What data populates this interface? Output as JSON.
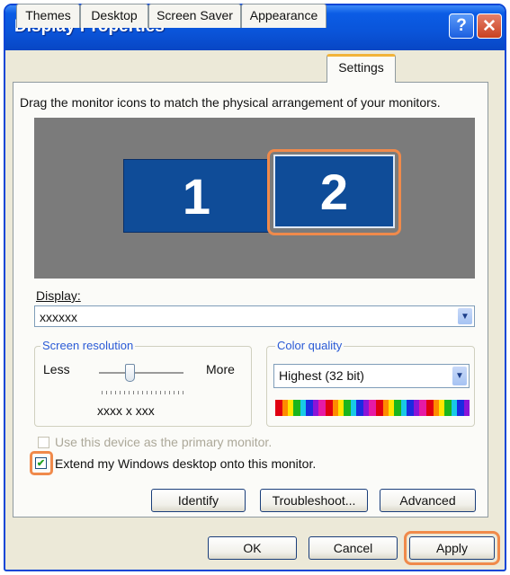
{
  "window": {
    "title": "Display Properties"
  },
  "titlebar": {
    "help_label": "?",
    "close_label": "✕"
  },
  "tabs": [
    {
      "label": "Themes"
    },
    {
      "label": "Desktop"
    },
    {
      "label": "Screen Saver"
    },
    {
      "label": "Appearance"
    },
    {
      "label": "Settings"
    }
  ],
  "settings": {
    "instruction": "Drag the monitor icons to match the physical arrangement of your monitors.",
    "monitors": [
      {
        "label": "1"
      },
      {
        "label": "2"
      }
    ],
    "display": {
      "label": "Display:",
      "value": "xxxxxx"
    },
    "screen_resolution": {
      "title": "Screen resolution",
      "less_label": "Less",
      "more_label": "More",
      "value": "xxxx x xxx"
    },
    "color_quality": {
      "title": "Color quality",
      "value": "Highest (32 bit)"
    },
    "primary_checkbox": {
      "label": "Use this device as the primary monitor.",
      "checked": false,
      "enabled": false
    },
    "extend_checkbox": {
      "label": "Extend my Windows desktop onto this monitor.",
      "checked": true
    }
  },
  "buttons": {
    "identify": "Identify",
    "troubleshoot": "Troubleshoot...",
    "advanced": "Advanced",
    "ok": "OK",
    "cancel": "Cancel",
    "apply": "Apply"
  },
  "colors": {
    "titlebar": "#0a54d9",
    "highlight": "#f08a4b",
    "monitor": "#0f4c98"
  }
}
